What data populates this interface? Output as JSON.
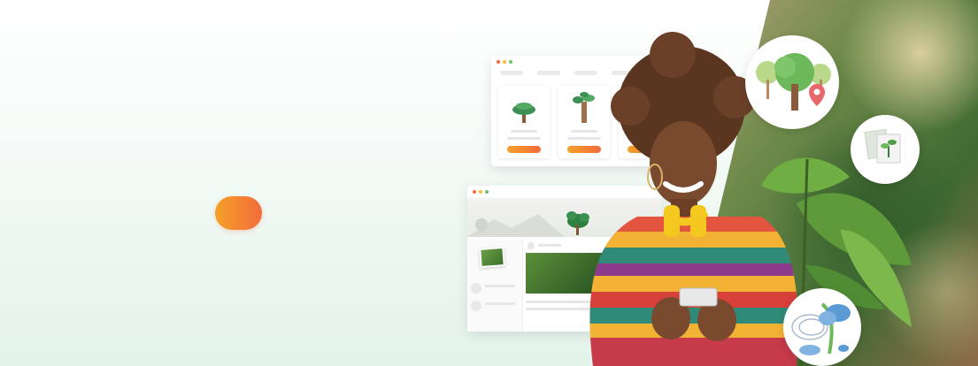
{
  "hero": {
    "cta_color_start": "#f5a12a",
    "cta_color_end": "#f26b3a",
    "background_color": "#e3f3ea",
    "accent_green": "#3a8f52"
  },
  "icons": {
    "trees_location": "trees-location-icon",
    "photo_plant": "photo-plant-icon",
    "tree_cloud": "tree-cloud-icon",
    "cart": "cart-icon"
  }
}
